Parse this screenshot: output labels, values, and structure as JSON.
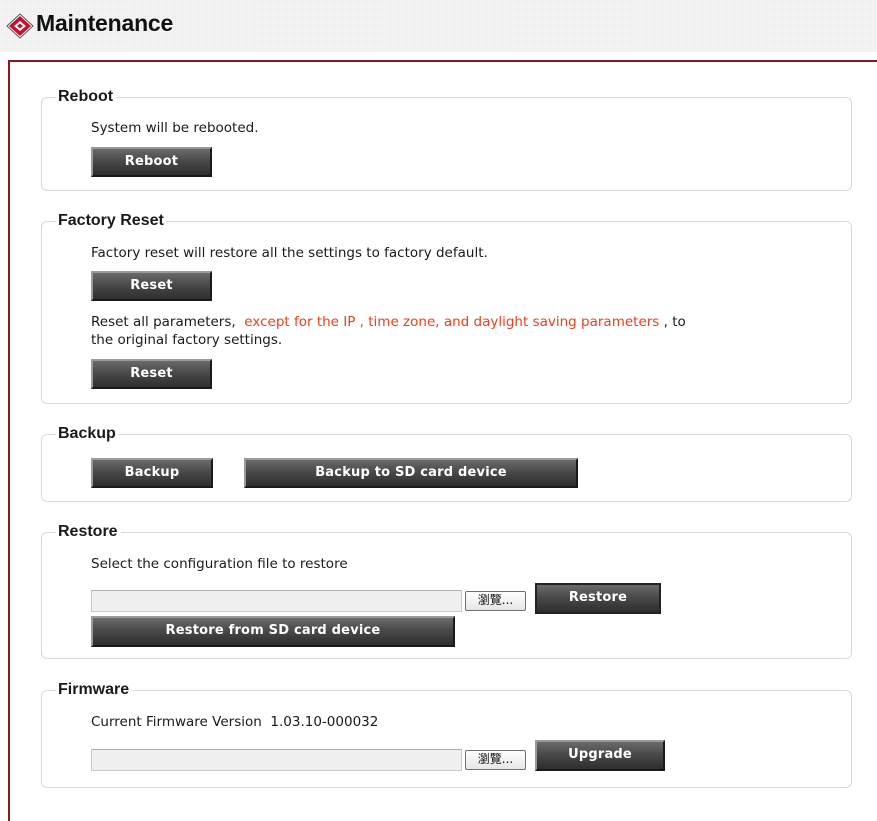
{
  "header": {
    "title": "Maintenance"
  },
  "reboot": {
    "legend": "Reboot",
    "description": "System will be rebooted.",
    "button_label": "Reboot"
  },
  "factory_reset": {
    "legend": "Factory Reset",
    "description": "Factory reset will restore all the settings to factory default.",
    "reset_button_label": "Reset",
    "partial_text_start": "Reset all parameters,",
    "partial_text_highlight": "except for the IP , time zone, and daylight saving parameters",
    "partial_text_end": ", to",
    "partial_text_line2": "the original factory settings.",
    "partial_reset_button_label": "Reset"
  },
  "backup": {
    "legend": "Backup",
    "backup_button_label": "Backup",
    "backup_sd_button_label": "Backup to SD card device"
  },
  "restore": {
    "legend": "Restore",
    "description": "Select the configuration file to restore",
    "file_input_value": "",
    "browse_label": "瀏覽...",
    "restore_button_label": "Restore",
    "restore_sd_button_label": "Restore from SD card device"
  },
  "firmware": {
    "legend": "Firmware",
    "version_label": "Current Firmware Version",
    "version_value": "1.03.10-000032",
    "file_input_value": "",
    "browse_label": "瀏覽...",
    "upgrade_button_label": "Upgrade"
  },
  "colors": {
    "accent_red": "#e8401c",
    "frame_border": "#8a1a1a",
    "button_dark": "#3a3a3a"
  },
  "icons": {
    "header_logo": "red-diamond-logo-icon"
  }
}
